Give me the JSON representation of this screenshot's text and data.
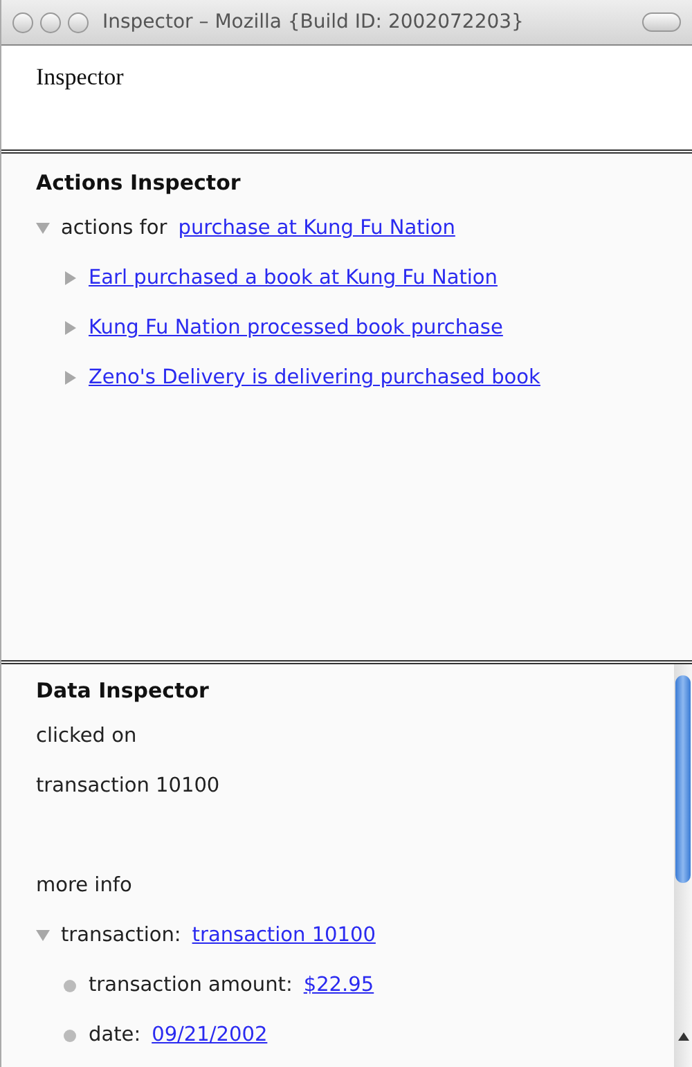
{
  "window": {
    "title": "Inspector – Mozilla {Build ID: 2002072203}"
  },
  "top_pane": {
    "heading": "Inspector"
  },
  "actions_inspector": {
    "heading": "Actions Inspector",
    "tree": {
      "label": "actions for",
      "link": "purchase at Kung Fu Nation",
      "expanded": true,
      "children": [
        {
          "link": "Earl purchased a book at Kung Fu Nation",
          "expanded": false
        },
        {
          "link": "Kung Fu Nation processed book purchase",
          "expanded": false
        },
        {
          "link": "Zeno's Delivery is delivering purchased book",
          "expanded": false
        }
      ]
    }
  },
  "data_inspector": {
    "heading": "Data Inspector",
    "clicked_label": "clicked on",
    "clicked_value": "transaction 10100",
    "more_info": "more info",
    "tree": {
      "label": "transaction:",
      "link": "transaction 10100",
      "expanded": true,
      "children": [
        {
          "label": "transaction amount:",
          "link": "$22.95"
        },
        {
          "label": "date:",
          "link": "09/21/2002"
        }
      ]
    }
  }
}
